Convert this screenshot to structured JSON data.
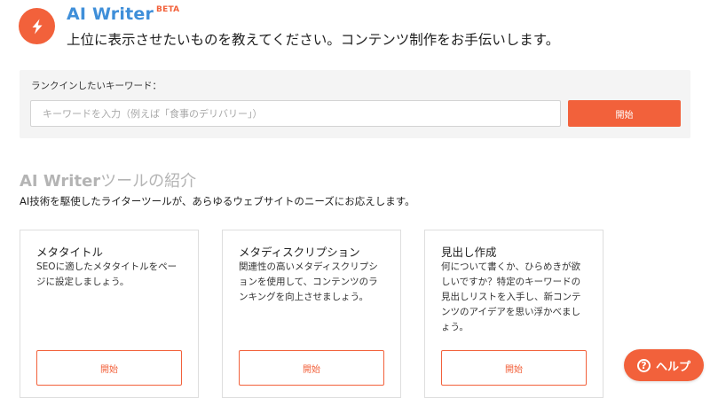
{
  "header": {
    "logo_icon": "lightning-bolt-icon",
    "brand": "AI Writer",
    "badge": "BETA",
    "tagline": "上位に表示させたいものを教えてください。コンテンツ制作をお手伝いします。"
  },
  "keyword": {
    "label": "ランクインしたいキーワード：",
    "placeholder": "キーワードを入力（例えば「食事のデリバリー」）",
    "value": "",
    "start_label": "開始"
  },
  "tools": {
    "title_latin": "AI Writer",
    "title_jp": "ツールの紹介",
    "description": "AI技術を駆使したライターツールが、あらゆるウェブサイトのニーズにお応えします。",
    "cards": [
      {
        "title": "メタタイトル",
        "desc_lines": [
          "SEOに適したメタタイトルをペー",
          "ジに設定しましょう。"
        ],
        "button": "開始"
      },
      {
        "title": "メタディスクリプション",
        "desc_lines": [
          "関連性の高いメタディスクリプシ",
          "ョンを使用して、コンテンツのラ",
          "ンキングを向上させましょう。"
        ],
        "button": "開始"
      },
      {
        "title": "見出し作成",
        "desc_lines": [
          "何について書くか、ひらめきが欲",
          "しいですか？特定のキーワードの",
          "見出しリストを入手し、新コンテ",
          "ンツのアイデアを思い浮かべまし",
          "ょう。"
        ],
        "button": "開始"
      }
    ]
  },
  "help": {
    "icon": "question-circle-icon",
    "label": "ヘルプ"
  },
  "colors": {
    "accent": "#f2613b",
    "brand_blue": "#3f8fd9",
    "panel_bg": "#f4f4f4"
  }
}
